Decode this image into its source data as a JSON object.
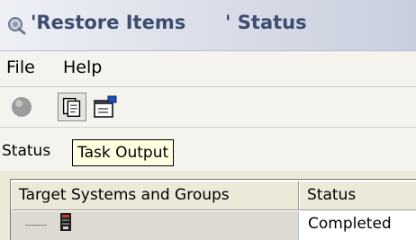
{
  "window": {
    "title": "'Restore Items      ' Status",
    "icon": "magnifier-status-icon"
  },
  "menu": {
    "items": [
      {
        "label": "File"
      },
      {
        "label": "Help"
      }
    ]
  },
  "toolbar": {
    "buttons": [
      {
        "icon": "stop-circle-icon",
        "state": "disabled"
      },
      {
        "icon": "task-output-icon",
        "state": "pressed"
      },
      {
        "icon": "properties-icon",
        "state": "normal"
      }
    ]
  },
  "status_row": {
    "label": "Status"
  },
  "tooltip": {
    "text": "Task Output"
  },
  "table": {
    "columns": [
      "Target Systems and Groups",
      "Status"
    ],
    "rows": [
      {
        "target_icon": "server-icon",
        "status": "Completed"
      }
    ]
  }
}
